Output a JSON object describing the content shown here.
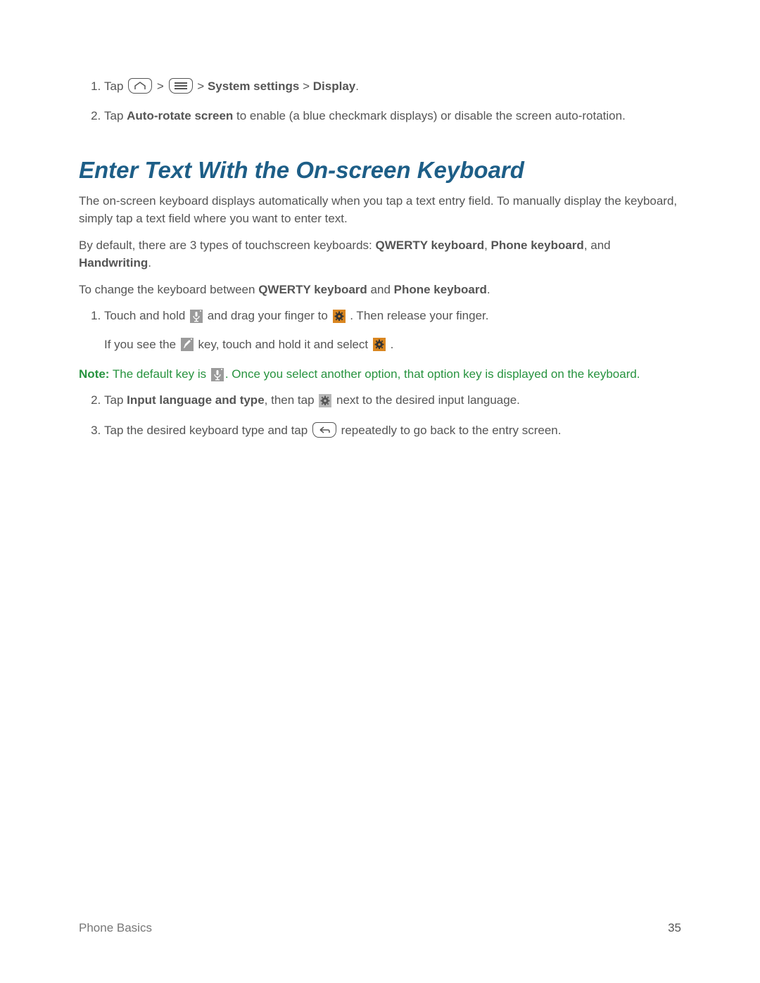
{
  "steps_a": {
    "item1": {
      "tap": "Tap",
      "gt1": ">",
      "gt2": ">",
      "system_settings": "System settings",
      "gt3": ">",
      "display": "Display",
      "period": "."
    },
    "item2": {
      "pre": "Tap ",
      "bold": "Auto-rotate screen",
      "post": " to enable (a blue checkmark displays) or disable the screen auto-rotation."
    }
  },
  "heading": "Enter Text With the On-screen Keyboard",
  "intro1": "The on-screen keyboard displays automatically when you tap a text entry field. To manually display the keyboard, simply tap a text field where you want to enter text.",
  "intro2": {
    "pre": "By default, there are 3 types of touchscreen keyboards: ",
    "b1": "QWERTY keyboard",
    "sep1": ", ",
    "b2": "Phone keyboard",
    "sep2": ", and ",
    "b3": "Handwriting",
    "post": "."
  },
  "intro3": {
    "pre": "To change the keyboard between ",
    "b1": "QWERTY keyboard",
    "mid": " and ",
    "b2": "Phone keyboard",
    "post": "."
  },
  "steps_b": {
    "item1": {
      "p1a": "Touch and hold ",
      "p1b": " and drag your finger to ",
      "p1c": ". Then release your finger.",
      "p2a": "If you see the ",
      "p2b": " key, touch and hold it and select ",
      "p2c": " ."
    },
    "note": {
      "label": "Note:",
      "a": " The default key is ",
      "b": ". Once you select another option, that option key is displayed on the keyboard."
    },
    "item2": {
      "pre": "Tap ",
      "bold": "Input language and type",
      "mid": ", then tap ",
      "post": " next to the desired input language."
    },
    "item3": {
      "pre": "Tap the desired keyboard type and tap ",
      "post": " repeatedly to go back to the entry screen."
    }
  },
  "footer": {
    "section": "Phone Basics",
    "page": "35"
  }
}
